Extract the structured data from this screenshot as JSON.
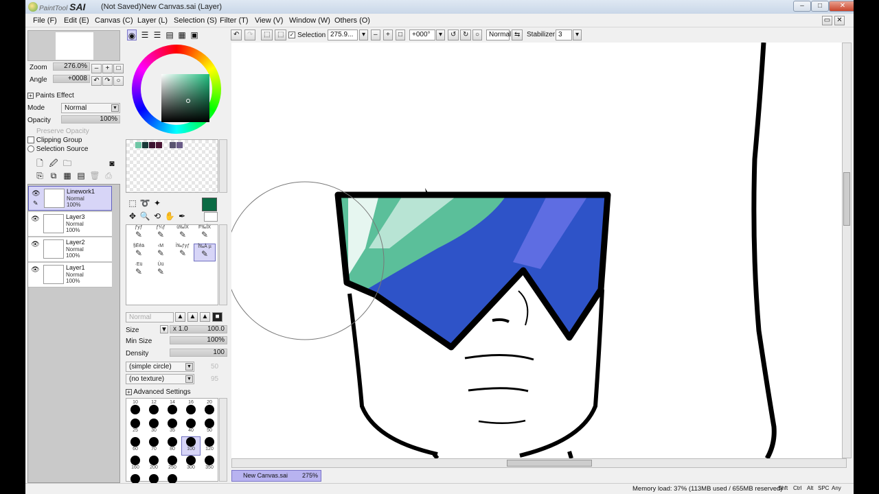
{
  "window": {
    "brand_small": "PaintTool",
    "brand_big": "SAI",
    "title": "(Not Saved)New Canvas.sai (Layer)",
    "buttons": [
      "–",
      "□",
      "✕"
    ]
  },
  "menu": [
    "File (F)",
    "Edit (E)",
    "Canvas (C)",
    "Layer (L)",
    "Selection (S)",
    "Filter (T)",
    "View (V)",
    "Window (W)",
    "Others (O)"
  ],
  "navigator": {
    "zoom_label": "Zoom",
    "zoom_value": "276.0%",
    "angle_label": "Angle",
    "angle_value": "+0008"
  },
  "layer_props": {
    "paints_effect": "Paints Effect",
    "mode_label": "Mode",
    "mode_value": "Normal",
    "opacity_label": "Opacity",
    "opacity_value": "100%",
    "preserve_opacity": "Preserve Opacity",
    "clipping_group": "Clipping Group",
    "selection_source": "Selection Source"
  },
  "layers": [
    {
      "name": "Linework1",
      "mode": "Normal",
      "opacity": "100%",
      "active": true
    },
    {
      "name": "Layer3",
      "mode": "Normal",
      "opacity": "100%",
      "active": false
    },
    {
      "name": "Layer2",
      "mode": "Normal",
      "opacity": "100%",
      "active": false
    },
    {
      "name": "Layer1",
      "mode": "Normal",
      "opacity": "100%",
      "active": false
    }
  ],
  "colors": {
    "current": "#0b6b44",
    "swatches": [
      "#6fc7a6",
      "#1a3b3a",
      "#3b1330",
      "#4a1635",
      "#5a5570",
      "#6a5c88"
    ]
  },
  "brushes": [
    {
      "code": "ƒyƒ",
      "sub": "",
      "sel": false
    },
    {
      "code": "ƒ¼ƒ",
      "sub": "",
      "sel": false
    },
    {
      "code": "ü‰ÍX",
      "sub": "",
      "sel": false
    },
    {
      "code": "F‰ÍX",
      "sub": "",
      "sel": false
    },
    {
      "code": "§Ëêä",
      "sub": "",
      "sel": false
    },
    {
      "code": "‹M",
      "sub": "",
      "sel": false
    },
    {
      "code": "Ì‰ƒyƒ",
      "sub": "",
      "sel": false
    },
    {
      "code": "Î‰À µ",
      "sub": "",
      "sel": true
    },
    {
      "code": "·Eü",
      "sub": "",
      "sel": false
    },
    {
      "code": "Üü",
      "sub": "",
      "sel": false
    }
  ],
  "brush_settings": {
    "blend_mode": "Normal",
    "size_label": "Size",
    "size_mult": "x 1.0",
    "size_value": "100.0",
    "minsize_label": "Min Size",
    "minsize_value": "100%",
    "density_label": "Density",
    "density_value": "100",
    "shape": "(simple circle)",
    "shape_value": "50",
    "texture": "(no texture)",
    "texture_value": "95",
    "advanced": "Advanced Settings"
  },
  "brush_sizes": [
    "10",
    "12",
    "14",
    "16",
    "20",
    "25",
    "30",
    "35",
    "40",
    "50",
    "60",
    "70",
    "80",
    "100",
    "120",
    "160",
    "200",
    "250",
    "300",
    "350",
    "400",
    "450",
    "500"
  ],
  "selected_size": "100",
  "canvas_toolbar": {
    "selection_label": "Selection",
    "zoom_value": "275.9...",
    "angle_value": "+000°",
    "blend_value": "Normal",
    "stabilizer_label": "Stabilizer",
    "stabilizer_value": "3"
  },
  "document_tab": {
    "name": "New Canvas.sai",
    "zoom": "275%"
  },
  "status": {
    "memory": "Memory load: 37% (113MB used / 655MB reserved)",
    "keys": [
      "Shft",
      "Ctrl",
      "Alt",
      "SPC",
      "Any"
    ]
  }
}
